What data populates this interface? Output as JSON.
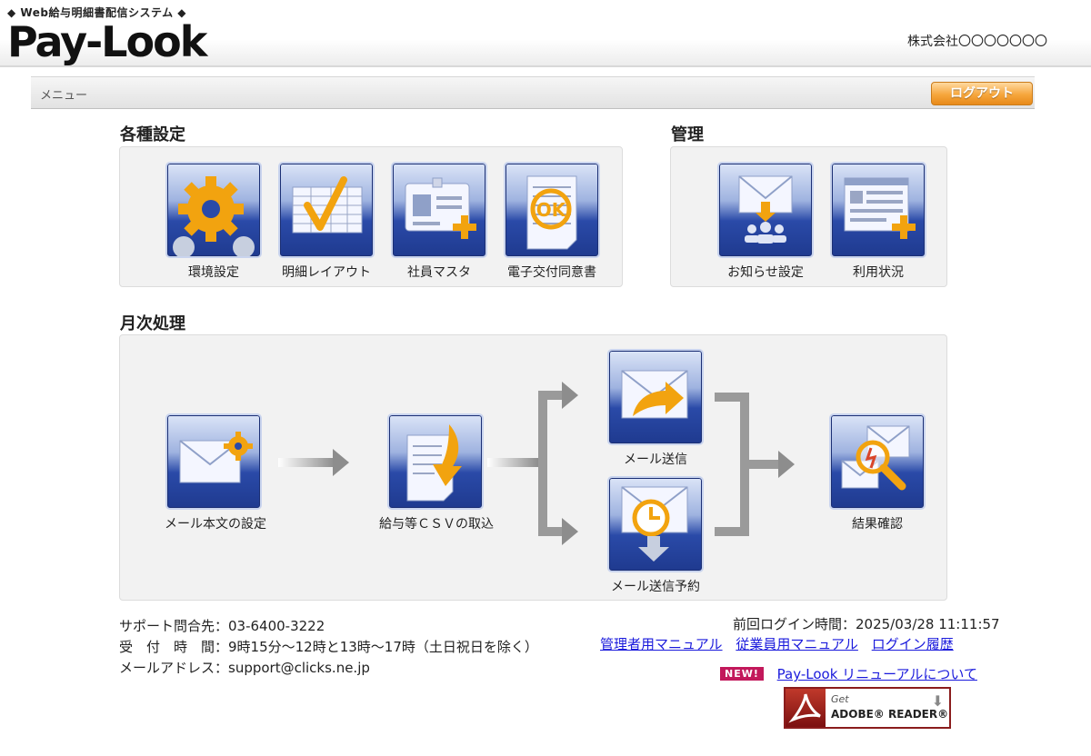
{
  "header": {
    "tagline": "◆ Web給与明細書配信システム ◆",
    "logo": "Pay-Look",
    "company": "株式会社〇〇〇〇〇〇〇"
  },
  "menubar": {
    "label": "メニュー",
    "logout": "ログアウト"
  },
  "settings": {
    "title": "各種設定",
    "items": [
      {
        "label": "環境設定",
        "icon": "gear-icon"
      },
      {
        "label": "明細レイアウト",
        "icon": "layout-icon"
      },
      {
        "label": "社員マスタ",
        "icon": "id-card-icon"
      },
      {
        "label": "電子交付同意書",
        "icon": "consent-document-icon"
      }
    ]
  },
  "admin": {
    "title": "管理",
    "items": [
      {
        "label": "お知らせ設定",
        "icon": "notice-icon"
      },
      {
        "label": "利用状況",
        "icon": "usage-icon"
      }
    ]
  },
  "monthly": {
    "title": "月次処理",
    "items": [
      {
        "label": "メール本文の設定",
        "icon": "mail-settings-icon"
      },
      {
        "label": "給与等ＣＳＶの取込",
        "icon": "csv-import-icon"
      },
      {
        "label": "メール送信",
        "icon": "mail-send-icon"
      },
      {
        "label": "メール送信予約",
        "icon": "mail-schedule-icon"
      },
      {
        "label": "結果確認",
        "icon": "result-check-icon"
      }
    ]
  },
  "footer": {
    "support_line": "サポート問合先：03-6400-3222",
    "hours_line": "受　付　時　間：9時15分～12時と13時～17時（土日祝日を除く）",
    "email_line": "メールアドレス：support@clicks.ne.jp",
    "last_login": "前回ログイン時間：2025/03/28 11:11:57",
    "links": [
      "管理者用マニュアル",
      "従業員用マニュアル",
      "ログイン履歴"
    ],
    "new_badge": "NEW!",
    "renewal_link": "Pay-Look リニューアルについて",
    "adobe_get": "Get",
    "adobe_reader": "ADOBE® READER®"
  },
  "colors": {
    "tile_blue": "#2a4aa8",
    "accent_orange": "#f6a63c",
    "link_blue": "#1a1adc"
  }
}
